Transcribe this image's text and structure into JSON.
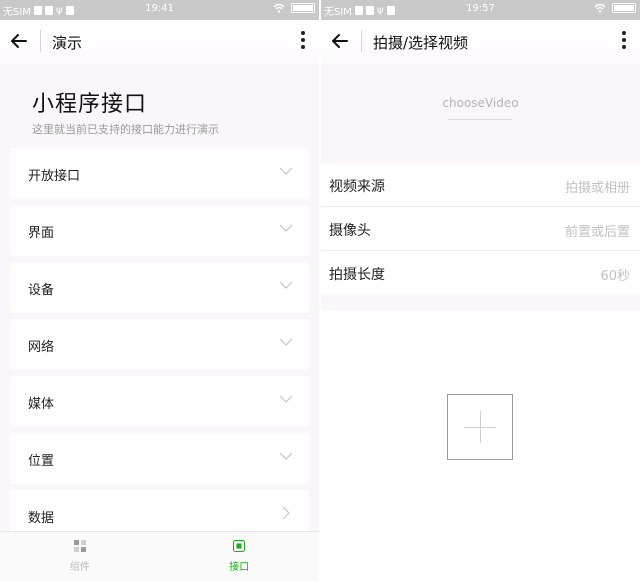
{
  "left": {
    "status": {
      "carrier": "无SIM",
      "time": "19:41"
    },
    "nav": {
      "title": "演示"
    },
    "header": {
      "title": "小程序接口",
      "desc": "这里就当前已支持的接口能力进行演示"
    },
    "kinds": [
      {
        "label": "开放接口",
        "icon": "chevron-down-icon"
      },
      {
        "label": "界面",
        "icon": "chevron-down-icon"
      },
      {
        "label": "设备",
        "icon": "chevron-down-icon"
      },
      {
        "label": "网络",
        "icon": "chevron-down-icon"
      },
      {
        "label": "媒体",
        "icon": "chevron-down-icon"
      },
      {
        "label": "位置",
        "icon": "chevron-down-icon"
      },
      {
        "label": "数据",
        "icon": "chevron-right-icon"
      }
    ],
    "tabbar": {
      "tabs": [
        {
          "label": "组件",
          "active": false,
          "icon": "component-icon"
        },
        {
          "label": "接口",
          "active": true,
          "icon": "api-icon"
        }
      ]
    }
  },
  "right": {
    "status": {
      "carrier": "无SIM",
      "time": "19:57"
    },
    "nav": {
      "title": "拍摄/选择视频"
    },
    "api_name": "chooseVideo",
    "form": [
      {
        "label": "视频来源",
        "value": "拍摄或相册"
      },
      {
        "label": "摄像头",
        "value": "前置或后置"
      },
      {
        "label": "拍摄长度",
        "value": "60秒"
      }
    ]
  },
  "colors": {
    "accent": "#1aad19",
    "status_bar": "#c9c9c9",
    "page_bg": "#fbf6fb"
  }
}
